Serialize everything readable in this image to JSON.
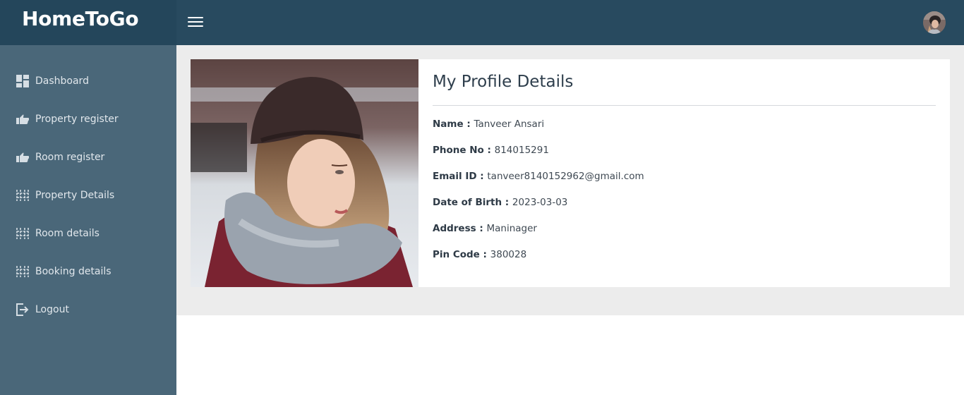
{
  "header": {
    "brand": "HomeToGo",
    "menu_icon": "hamburger-icon",
    "avatar_icon": "user-avatar"
  },
  "sidebar": {
    "items": [
      {
        "label": "Dashboard",
        "icon": "dashboard-icon"
      },
      {
        "label": "Property register",
        "icon": "thumbs-up-icon"
      },
      {
        "label": "Room register",
        "icon": "thumbs-up-icon"
      },
      {
        "label": "Property Details",
        "icon": "grid-icon"
      },
      {
        "label": "Room details",
        "icon": "grid-icon"
      },
      {
        "label": "Booking details",
        "icon": "grid-icon"
      },
      {
        "label": "Logout",
        "icon": "logout-icon"
      }
    ]
  },
  "profile": {
    "title": "My Profile Details",
    "fields": [
      {
        "label": "Name :",
        "value": "Tanveer Ansari"
      },
      {
        "label": "Phone No :",
        "value": "814015291"
      },
      {
        "label": "Email ID :",
        "value": "tanveer8140152962@gmail.com"
      },
      {
        "label": "Date of Birth :",
        "value": "2023-03-03"
      },
      {
        "label": "Address :",
        "value": "Maninager"
      },
      {
        "label": "Pin Code :",
        "value": "380028"
      }
    ]
  },
  "colors": {
    "header": "#284a5f",
    "sidebar": "#4a6779",
    "content_bg": "#ececec"
  }
}
